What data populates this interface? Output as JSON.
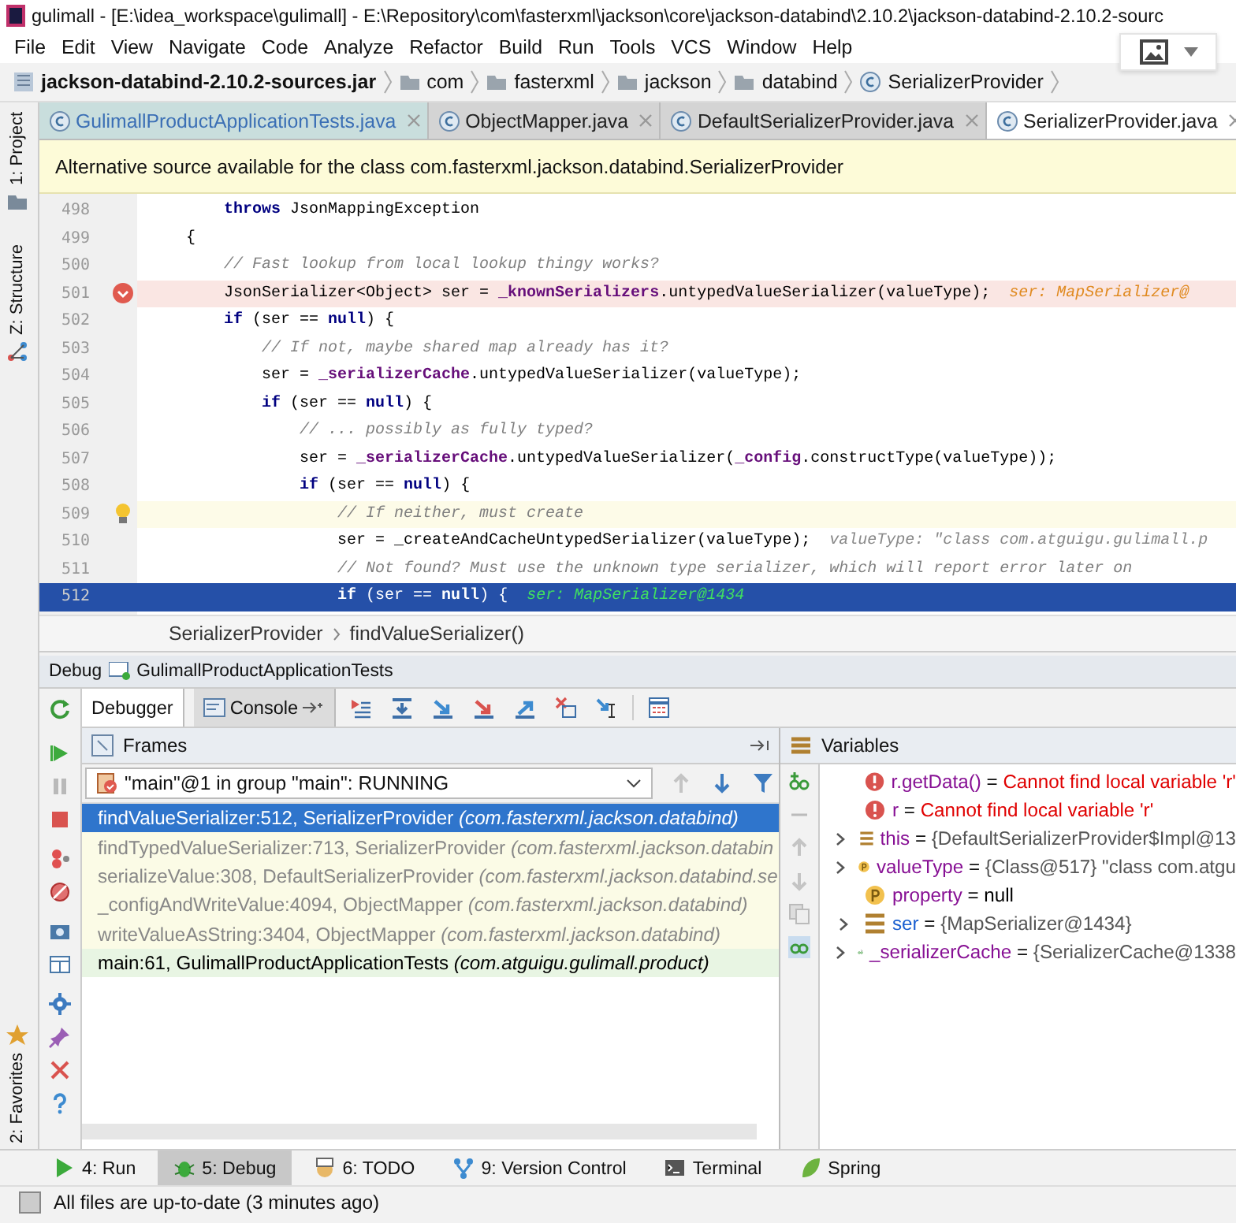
{
  "window": {
    "title": "gulimall - [E:\\idea_workspace\\gulimall] - E:\\Repository\\com\\fasterxml\\jackson\\core\\jackson-databind\\2.10.2\\jackson-databind-2.10.2-sourc"
  },
  "menu": [
    "File",
    "Edit",
    "View",
    "Navigate",
    "Code",
    "Analyze",
    "Refactor",
    "Build",
    "Run",
    "Tools",
    "VCS",
    "Window",
    "Help"
  ],
  "breadcrumb": [
    {
      "kind": "jar",
      "label": "jackson-databind-2.10.2-sources.jar"
    },
    {
      "kind": "folder",
      "label": "com"
    },
    {
      "kind": "folder",
      "label": "fasterxml"
    },
    {
      "kind": "folder",
      "label": "jackson"
    },
    {
      "kind": "folder",
      "label": "databind"
    },
    {
      "kind": "class",
      "label": "SerializerProvider"
    }
  ],
  "side_tools": [
    "1: Project",
    "Z: Structure",
    "2: Favorites"
  ],
  "editor_tabs": [
    {
      "label": "GulimallProductApplicationTests.java",
      "selected": false,
      "color": "#3b6fb5"
    },
    {
      "label": "ObjectMapper.java",
      "selected": false,
      "color": "#222222"
    },
    {
      "label": "DefaultSerializerProvider.java",
      "selected": false,
      "color": "#222222"
    },
    {
      "label": "SerializerProvider.java",
      "selected": true,
      "color": "#222222"
    }
  ],
  "notification": "Alternative source available for the class com.fasterxml.jackson.databind.SerializerProvider",
  "code_lines": [
    {
      "number": "498",
      "kind": "normal",
      "code": [
        {
          "kind": "keyword",
          "text": "        throws"
        },
        {
          "kind": "plain",
          "text": " JsonMappingException"
        }
      ]
    },
    {
      "number": "499",
      "kind": "normal",
      "code": [
        {
          "kind": "plain",
          "text": "    {"
        }
      ]
    },
    {
      "number": "500",
      "kind": "normal",
      "code": [
        {
          "kind": "comment",
          "text": "        // Fast lookup from local lookup thingy works?"
        }
      ]
    },
    {
      "number": "501",
      "kind": "breakpoint",
      "code": [
        {
          "kind": "plain",
          "text": "        JsonSerializer<Object> ser = "
        },
        {
          "kind": "field",
          "text": "_knownSerializers"
        },
        {
          "kind": "plain",
          "text": ".untypedValueSerializer(valueType);"
        }
      ],
      "hint": {
        "text": "ser: MapSerializer@",
        "kind": "changed"
      }
    },
    {
      "number": "502",
      "kind": "normal",
      "code": [
        {
          "kind": "keyword",
          "text": "        if"
        },
        {
          "kind": "plain",
          "text": " (ser == "
        },
        {
          "kind": "keyword",
          "text": "null"
        },
        {
          "kind": "plain",
          "text": ") {"
        }
      ]
    },
    {
      "number": "503",
      "kind": "normal",
      "code": [
        {
          "kind": "comment",
          "text": "            // If not, maybe shared map already has it?"
        }
      ]
    },
    {
      "number": "504",
      "kind": "normal",
      "code": [
        {
          "kind": "plain",
          "text": "            ser = "
        },
        {
          "kind": "field",
          "text": "_serializerCache"
        },
        {
          "kind": "plain",
          "text": ".untypedValueSerializer(valueType);"
        }
      ]
    },
    {
      "number": "505",
      "kind": "normal",
      "code": [
        {
          "kind": "keyword",
          "text": "            if"
        },
        {
          "kind": "plain",
          "text": " (ser == "
        },
        {
          "kind": "keyword",
          "text": "null"
        },
        {
          "kind": "plain",
          "text": ") {"
        }
      ]
    },
    {
      "number": "506",
      "kind": "normal",
      "code": [
        {
          "kind": "comment",
          "text": "                // ... possibly as fully typed?"
        }
      ]
    },
    {
      "number": "507",
      "kind": "normal",
      "code": [
        {
          "kind": "plain",
          "text": "                ser = "
        },
        {
          "kind": "field",
          "text": "_serializerCache"
        },
        {
          "kind": "plain",
          "text": ".untypedValueSerializer("
        },
        {
          "kind": "field",
          "text": "_config"
        },
        {
          "kind": "plain",
          "text": ".constructType(valueType));"
        }
      ]
    },
    {
      "number": "508",
      "kind": "normal",
      "code": [
        {
          "kind": "keyword",
          "text": "                if"
        },
        {
          "kind": "plain",
          "text": " (ser == "
        },
        {
          "kind": "keyword",
          "text": "null"
        },
        {
          "kind": "plain",
          "text": ") {"
        }
      ]
    },
    {
      "number": "509",
      "kind": "bulb",
      "code": [
        {
          "kind": "comment",
          "text": "                    // If neither, must create"
        }
      ]
    },
    {
      "number": "510",
      "kind": "normal",
      "code": [
        {
          "kind": "plain",
          "text": "                    ser = _createAndCacheUntypedSerializer(valueType);"
        }
      ],
      "hint": {
        "text": "valueType: \"class com.atguigu.gulimall.p",
        "kind": "plain"
      }
    },
    {
      "number": "511",
      "kind": "normal",
      "code": [
        {
          "kind": "comment",
          "text": "                    // Not found? Must use the unknown type serializer, which will report error later on"
        }
      ]
    },
    {
      "number": "512",
      "kind": "execution",
      "code": [
        {
          "kind": "keyword",
          "text": "                    if"
        },
        {
          "kind": "plain",
          "text": " (ser == "
        },
        {
          "kind": "keyword",
          "text": "null"
        },
        {
          "kind": "plain",
          "text": ") {"
        }
      ],
      "hint": {
        "text": "ser: MapSerializer@1434",
        "kind": "execution"
      }
    }
  ],
  "editor_breadcrumb": [
    "SerializerProvider",
    "findValueSerializer()"
  ],
  "debug": {
    "label": "Debug",
    "config": "GulimallProductApplicationTests",
    "tabs": [
      {
        "label": "Debugger",
        "selected": true
      },
      {
        "label": "Console",
        "selected": false
      }
    ],
    "frames_title": "Frames",
    "variables_title": "Variables",
    "thread": "\"main\"@1 in group \"main\": RUNNING",
    "frames": [
      {
        "text": "findValueSerializer:512, SerializerProvider *(com.fasterxml.jackson.databind)*",
        "kind": "library",
        "selected": true
      },
      {
        "text": "findTypedValueSerializer:713, SerializerProvider *(com.fasterxml.jackson.databin*",
        "kind": "library",
        "selected": false
      },
      {
        "text": "serializeValue:308, DefaultSerializerProvider *(com.fasterxml.jackson.databind.se*",
        "kind": "library",
        "selected": false
      },
      {
        "text": "_configAndWriteValue:4094, ObjectMapper *(com.fasterxml.jackson.databind)*",
        "kind": "library",
        "selected": false
      },
      {
        "text": "writeValueAsString:3404, ObjectMapper *(com.fasterxml.jackson.databind)*",
        "kind": "library",
        "selected": false
      },
      {
        "text": "main:61, GulimallProductApplicationTests *(com.atguigu.gulimall.product)*",
        "kind": "user",
        "selected": false
      }
    ],
    "variables": [
      {
        "kind": "error",
        "name": "r.getData()",
        "separator": "=",
        "value": "Cannot find local variable 'r'",
        "expandable": false,
        "changed": false
      },
      {
        "kind": "error",
        "name": "r",
        "separator": "=",
        "value": "Cannot find local variable 'r'",
        "expandable": false,
        "changed": false
      },
      {
        "kind": "field",
        "name": "this",
        "separator": "=",
        "value": "{DefaultSerializerProvider$Impl@13",
        "expandable": true,
        "changed": false
      },
      {
        "kind": "param",
        "name": "valueType",
        "separator": "=",
        "value": "{Class@517} \"class com.atgu",
        "expandable": true,
        "changed": false
      },
      {
        "kind": "param",
        "name": "property",
        "separator": "=",
        "value": "null",
        "expandable": false,
        "changed": false
      },
      {
        "kind": "field",
        "name": "ser",
        "separator": "=",
        "value": "{MapSerializer@1434}",
        "expandable": true,
        "changed": true
      },
      {
        "kind": "watch",
        "name": "_serializerCache",
        "separator": "=",
        "value": "{SerializerCache@1338",
        "expandable": true,
        "changed": false
      }
    ]
  },
  "tool_windows": [
    {
      "label": "4: Run",
      "kind": "run",
      "selected": false
    },
    {
      "label": "5: Debug",
      "kind": "debug",
      "selected": true
    },
    {
      "label": "6: TODO",
      "kind": "todo",
      "selected": false
    },
    {
      "label": "9: Version Control",
      "kind": "vcs",
      "selected": false
    },
    {
      "label": "Terminal",
      "kind": "terminal",
      "selected": false
    },
    {
      "label": "Spring",
      "kind": "spring",
      "selected": false
    }
  ],
  "status": "All files are up-to-date (3 minutes ago)"
}
